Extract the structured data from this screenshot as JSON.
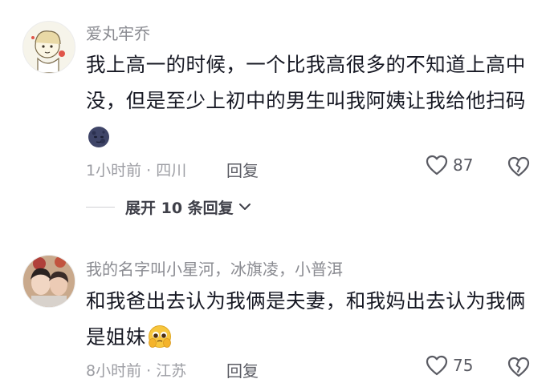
{
  "comments": [
    {
      "username": "爱丸牢乔",
      "text": "我上高一的时候，一个比我高很多的不知道上高中没，但是至少上初中的男生叫我阿姨让我给他扫码",
      "meta": "1小时前 · 四川",
      "reply_label": "回复",
      "likes": "87",
      "emoji": "moon-face-emoji",
      "expand_label": "展开 10 条回复"
    },
    {
      "username": "我的名字叫小星河，冰旗凌，小普洱",
      "text": "和我爸出去认为我俩是夫妻，和我妈出去认为我俩是姐妹",
      "meta": "8小时前 · 江苏",
      "reply_label": "回复",
      "likes": "75",
      "emoji": "pleading-face-emoji"
    }
  ],
  "icons": {
    "like": "heart-outline-icon",
    "dislike": "broken-heart-icon",
    "expand": "chevron-down-icon"
  },
  "colors": {
    "text": "#161823",
    "muted": "#8a8b91",
    "icon": "#5a5b63"
  }
}
